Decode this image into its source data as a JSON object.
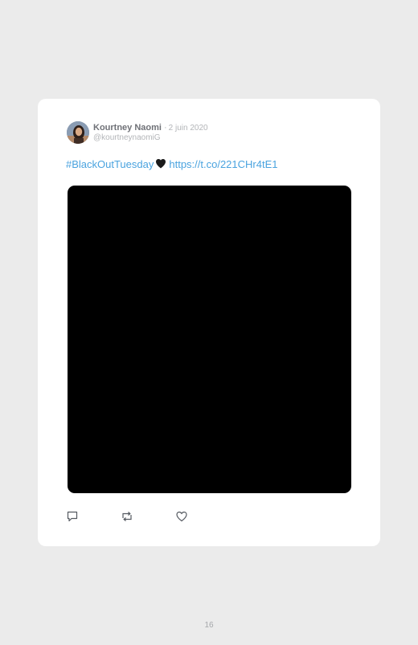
{
  "tweet": {
    "author_name": "Kourtney Naomi",
    "separator": "·",
    "date": "2 juin 2020",
    "handle": "@kourtneynaomiG",
    "hashtag": "#BlackOutTuesday",
    "emoji": "black-heart",
    "link": "https://t.co/221CHr4tE1",
    "media": {
      "kind": "image",
      "fill_color": "#000000"
    }
  },
  "actions": {
    "reply_icon": "comment-icon",
    "retweet_icon": "retweet-icon",
    "like_icon": "heart-icon"
  },
  "page": {
    "number": "16"
  },
  "colors": {
    "background": "#ebebeb",
    "card": "#ffffff",
    "link": "#4aa3df",
    "name": "#6f7177",
    "muted": "#b3b5b8"
  }
}
